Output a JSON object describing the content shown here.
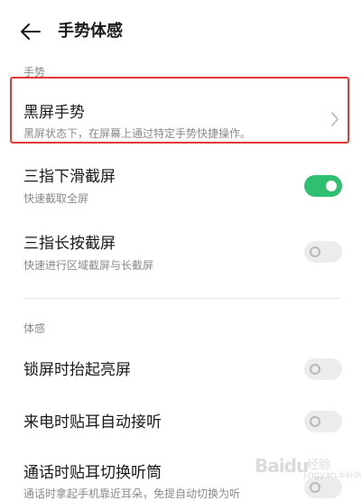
{
  "header": {
    "title": "手势体感",
    "back_icon": "arrow-left-icon"
  },
  "sections": {
    "gesture_label": "手势",
    "motion_label": "体感"
  },
  "items": {
    "black_screen_gesture": {
      "title": "黑屏手势",
      "subtitle": "黑屏状态下，在屏幕上通过特定手势快捷操作。",
      "icon": "chevron-right-icon"
    },
    "three_finger_swipe": {
      "title": "三指下滑截屏",
      "subtitle": "快速截取全屏",
      "enabled": true
    },
    "three_finger_hold": {
      "title": "三指长按截屏",
      "subtitle": "快速进行区域截屏与长截屏",
      "enabled": false
    },
    "raise_to_wake": {
      "title": "锁屏时抬起亮屏",
      "enabled": false
    },
    "auto_answer": {
      "title": "来电时贴耳自动接听",
      "enabled": false
    },
    "switch_earpiece": {
      "title": "通话时贴耳切换听筒",
      "subtitle": "通话时拿起手机靠近耳朵，免提自动切换为听",
      "enabled": false
    }
  },
  "colors": {
    "toggle_on": "#2fbf71",
    "toggle_off": "#ececec",
    "highlight": "#e53935"
  },
  "watermark": {
    "brand": "Baidu",
    "text": "经验",
    "url_fragment": "jingyan.baidu.com"
  }
}
